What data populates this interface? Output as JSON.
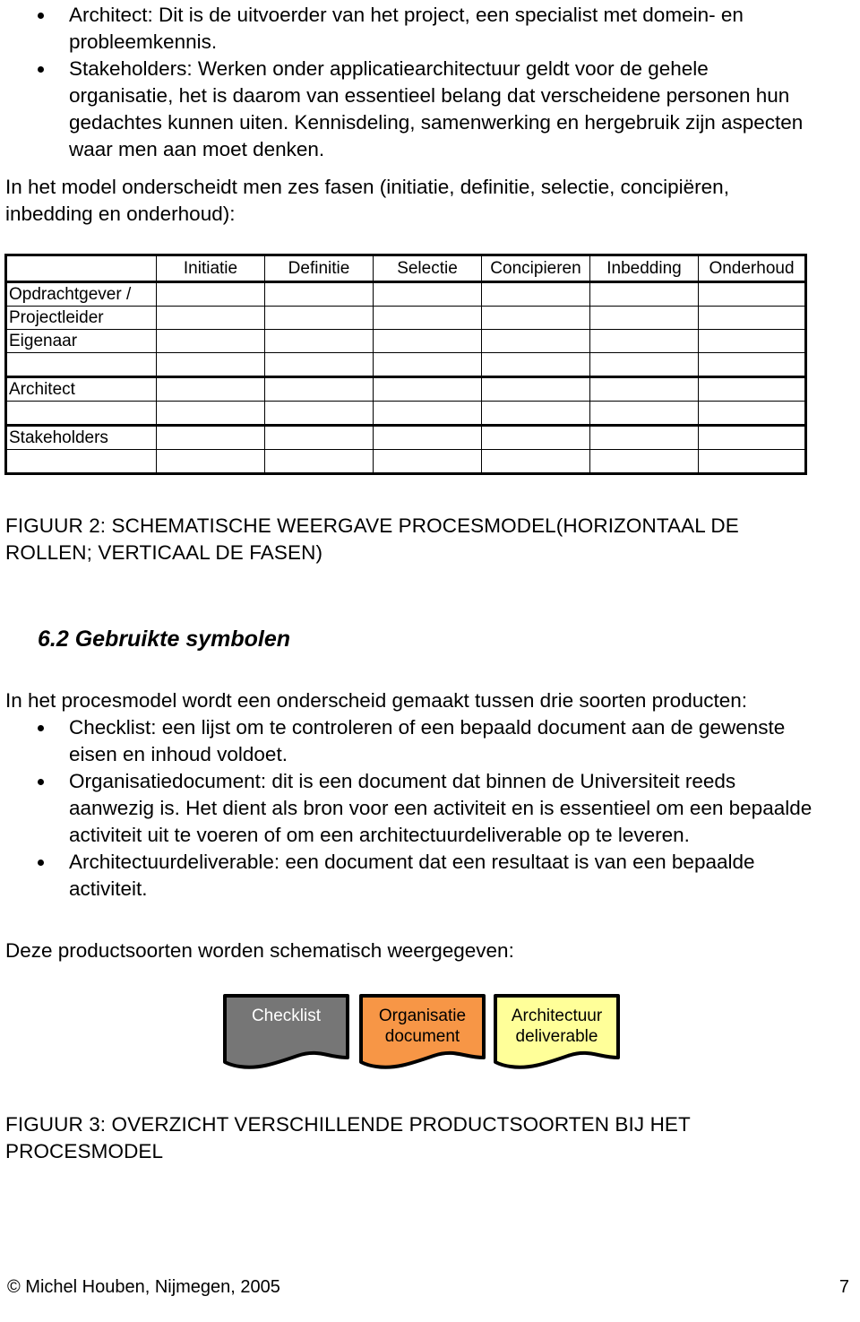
{
  "document": {
    "page_number": "7",
    "footer_copyright": "© Michel Houben, Nijmegen, 2005"
  },
  "roles_bullets": [
    "Architect: Dit is de uitvoerder van het project, een specialist met domein- en probleemkennis.",
    "Stakeholders: Werken onder applicatiearchitectuur geldt voor de gehele organisatie, het is daarom van essentieel belang dat verscheidene personen hun gedachtes kunnen uiten. Kennisdeling, samenwerking en hergebruik zijn aspecten waar men aan moet denken."
  ],
  "intro_paragraph": "In het model onderscheidt men zes fasen (initiatie, definitie, selectie, concipiëren, inbedding en onderhoud):",
  "process_table": {
    "corner_label": "",
    "columns": [
      "Initiatie",
      "Definitie",
      "Selectie",
      "Concipieren",
      "Inbedding",
      "Onderhoud"
    ],
    "rows": [
      {
        "label": "Opdrachtgever /",
        "group_end": false
      },
      {
        "label": "Projectleider",
        "group_end": false
      },
      {
        "label": "Eigenaar",
        "group_end": false
      },
      {
        "label": "",
        "group_end": true
      },
      {
        "label": "Architect",
        "group_end": false
      },
      {
        "label": "",
        "group_end": true
      },
      {
        "label": "Stakeholders",
        "group_end": false
      },
      {
        "label": "",
        "group_end": true
      }
    ]
  },
  "figure2_caption": "FIGUUR 2: SCHEMATISCHE WEERGAVE PROCESMODEL(HORIZONTAAL DE ROLLEN; VERTICAAL DE FASEN)",
  "section": {
    "heading": "6.2 Gebruikte symbolen",
    "intro": "In het procesmodel wordt een onderscheid gemaakt tussen drie soorten producten:",
    "bullets": [
      "Checklist: een lijst om te controleren of een bepaald document aan de gewenste eisen en inhoud voldoet.",
      "Organisatiedocument: dit is een document dat binnen de Universiteit reeds aanwezig is. Het dient als bron voor een activiteit en is essentieel om een bepaalde activiteit uit te voeren of om een architectuurdeliverable op te leveren.",
      "Architectuurdeliverable: een document dat een resultaat is van een bepaalde activiteit."
    ],
    "closing": "Deze productsoorten worden schematisch weergegeven:"
  },
  "symbols": [
    {
      "line1": "Checklist",
      "line2": "",
      "fill": "#767676",
      "text_color": "#FFFFFF",
      "stroke": "#000000"
    },
    {
      "line1": "Organisatie",
      "line2": "document",
      "fill": "#F79646",
      "text_color": "#000000",
      "stroke": "#000000"
    },
    {
      "line1": "Architectuur",
      "line2": "deliverable",
      "fill": "#FFFF99",
      "text_color": "#000000",
      "stroke": "#000000"
    }
  ],
  "figure3_caption": "FIGUUR 3: OVERZICHT VERSCHILLENDE PRODUCTSOORTEN BIJ HET PROCESMODEL"
}
